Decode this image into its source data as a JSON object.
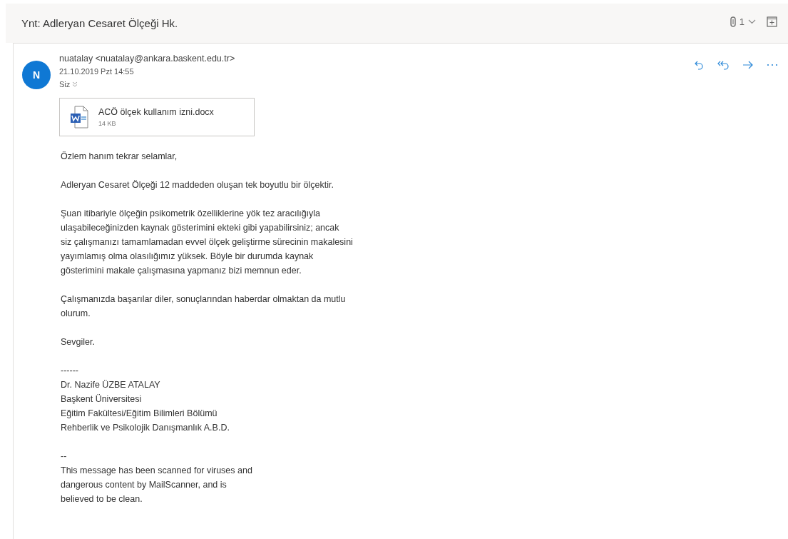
{
  "subject": "Ynt: Adleryan Cesaret Ölçeği Hk.",
  "header_actions": {
    "attachment_count": "1"
  },
  "message": {
    "avatar_letter": "N",
    "sender": "nuatalay <nuatalay@ankara.baskent.edu.tr>",
    "date": "21.10.2019 Pzt 14:55",
    "recipient": "Siz",
    "attachment": {
      "name": "ACÖ ölçek kullanım izni.docx",
      "size": "14 KB"
    },
    "paragraphs": [
      [
        "Özlem hanım tekrar selamlar,"
      ],
      [
        "Adleryan Cesaret Ölçeği 12 maddeden oluşan tek boyutlu bir ölçektir."
      ],
      [
        "Şuan itibariyle ölçeğin psikometrik özelliklerine yök tez aracılığıyla",
        "ulaşabileceğinizden kaynak gösterimini ekteki gibi yapabilirsiniz; ancak",
        "siz çalışmanızı tamamlamadan evvel ölçek geliştirme sürecinin makalesini",
        "yayımlamış olma olasılığımız yüksek. Böyle bir durumda kaynak",
        "gösterimini makale çalışmasına yapmanız bizi memnun eder."
      ],
      [
        "Çalışmanızda başarılar diler, sonuçlarından haberdar olmaktan da mutlu",
        "olurum."
      ],
      [
        "Sevgiler."
      ],
      [
        "------",
        "Dr. Nazife ÜZBE ATALAY",
        "Başkent Üniversitesi",
        "Eğitim Fakültesi/Eğitim Bilimleri Bölümü",
        "Rehberlik ve Psikolojik Danışmanlık A.B.D."
      ],
      [
        "--",
        "This message has been scanned for viruses and",
        "dangerous content by MailScanner, and is",
        "believed to be clean."
      ]
    ]
  }
}
